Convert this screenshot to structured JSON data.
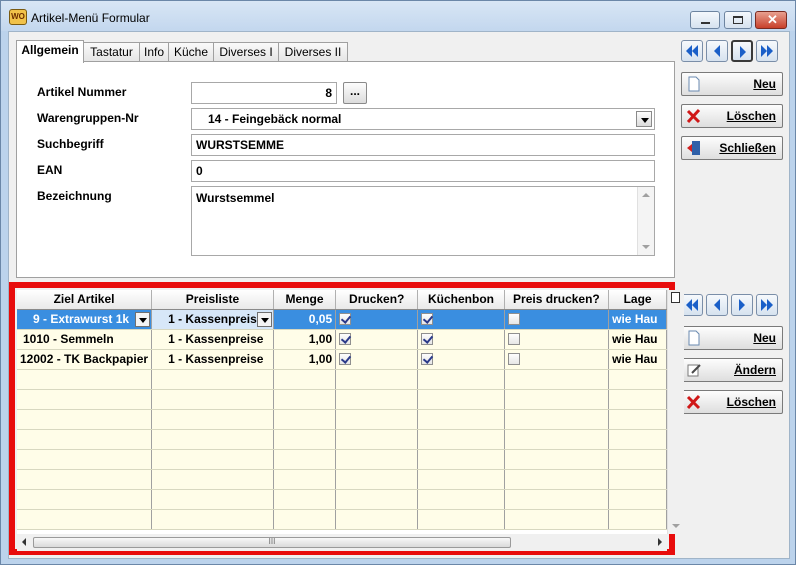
{
  "window": {
    "title": "Artikel-Menü Formular",
    "app_icon_text": "WO"
  },
  "tabs": [
    {
      "label": "Allgemein",
      "active": true
    },
    {
      "label": "Tastatur",
      "active": false
    },
    {
      "label": "Info",
      "active": false
    },
    {
      "label": "Küche",
      "active": false
    },
    {
      "label": "Diverses I",
      "active": false
    },
    {
      "label": "Diverses II",
      "active": false
    }
  ],
  "form": {
    "artikel_nummer": {
      "label": "Artikel Nummer",
      "value": "8",
      "browse_label": "..."
    },
    "warengruppe": {
      "label": "Warengruppen-Nr",
      "value": "14 - Feingebäck normal"
    },
    "suchbegriff": {
      "label": "Suchbegriff",
      "value": "WURSTSEMME"
    },
    "ean": {
      "label": "EAN",
      "value": "0"
    },
    "bezeichnung": {
      "label": "Bezeichnung",
      "value": "Wurstsemmel"
    }
  },
  "top_actions": {
    "neu": "Neu",
    "loeschen": "Löschen",
    "schliessen": "Schließen"
  },
  "bottom_actions": {
    "neu": "Neu",
    "aendern": "Ändern",
    "loeschen": "Löschen"
  },
  "grid": {
    "columns": [
      "Ziel Artikel",
      "Preisliste",
      "Menge",
      "Drucken?",
      "Küchenbon",
      "Preis drucken?",
      "Lage"
    ],
    "rows": [
      {
        "ziel": "9 - Extrawurst 1k",
        "preisliste": "1 - Kassenpreis",
        "menge": "0,05",
        "drucken": true,
        "kuechenbon": true,
        "preis_drucken": false,
        "lage": "wie Hau"
      },
      {
        "ziel": "1010 - Semmeln",
        "preisliste": "1 - Kassenpreise",
        "menge": "1,00",
        "drucken": true,
        "kuechenbon": true,
        "preis_drucken": false,
        "lage": "wie Hau"
      },
      {
        "ziel": "12002 - TK Backpapier",
        "preisliste": "1 - Kassenpreise",
        "menge": "1,00",
        "drucken": true,
        "kuechenbon": true,
        "preis_drucken": false,
        "lage": "wie Hau"
      }
    ],
    "empty_rows": 8,
    "scroll_grip": "III"
  },
  "colors": {
    "highlight": "#e80c0c",
    "selection": "#3a8ee0",
    "row_bg": "#fffde8"
  }
}
